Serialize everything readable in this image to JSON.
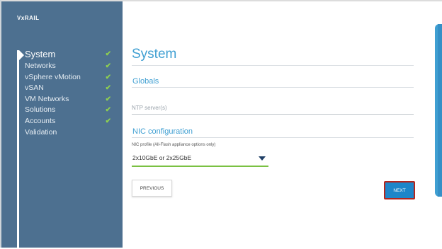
{
  "app": {
    "logo": "VxRAIL"
  },
  "sidebar": {
    "items": [
      {
        "label": "System",
        "done": true,
        "active": true
      },
      {
        "label": "Networks",
        "done": true
      },
      {
        "label": "vSphere vMotion",
        "done": true
      },
      {
        "label": "vSAN",
        "done": true
      },
      {
        "label": "VM Networks",
        "done": true
      },
      {
        "label": "Solutions",
        "done": true
      },
      {
        "label": "Accounts",
        "done": true
      },
      {
        "label": "Validation",
        "done": false
      }
    ],
    "check_glyph": "✔"
  },
  "main": {
    "title": "System",
    "globals_label": "Globals",
    "ntp": {
      "placeholder": "NTP server(s)",
      "value": ""
    },
    "nic_section_label": "NIC configuration",
    "nic_profile": {
      "label": "NIC profile (All-Flash appliance options only)",
      "selected": "2x10GbE or 2x25GbE"
    },
    "previous_label": "PREVIOUS",
    "next_label": "NEXT"
  },
  "colors": {
    "sidebar_bg": "#4d7090",
    "accent_blue": "#3f9fd2",
    "check_green": "#8fd14f",
    "select_underline": "#7ac142",
    "next_button": "#1e86c9",
    "next_highlight": "#b3261e"
  }
}
